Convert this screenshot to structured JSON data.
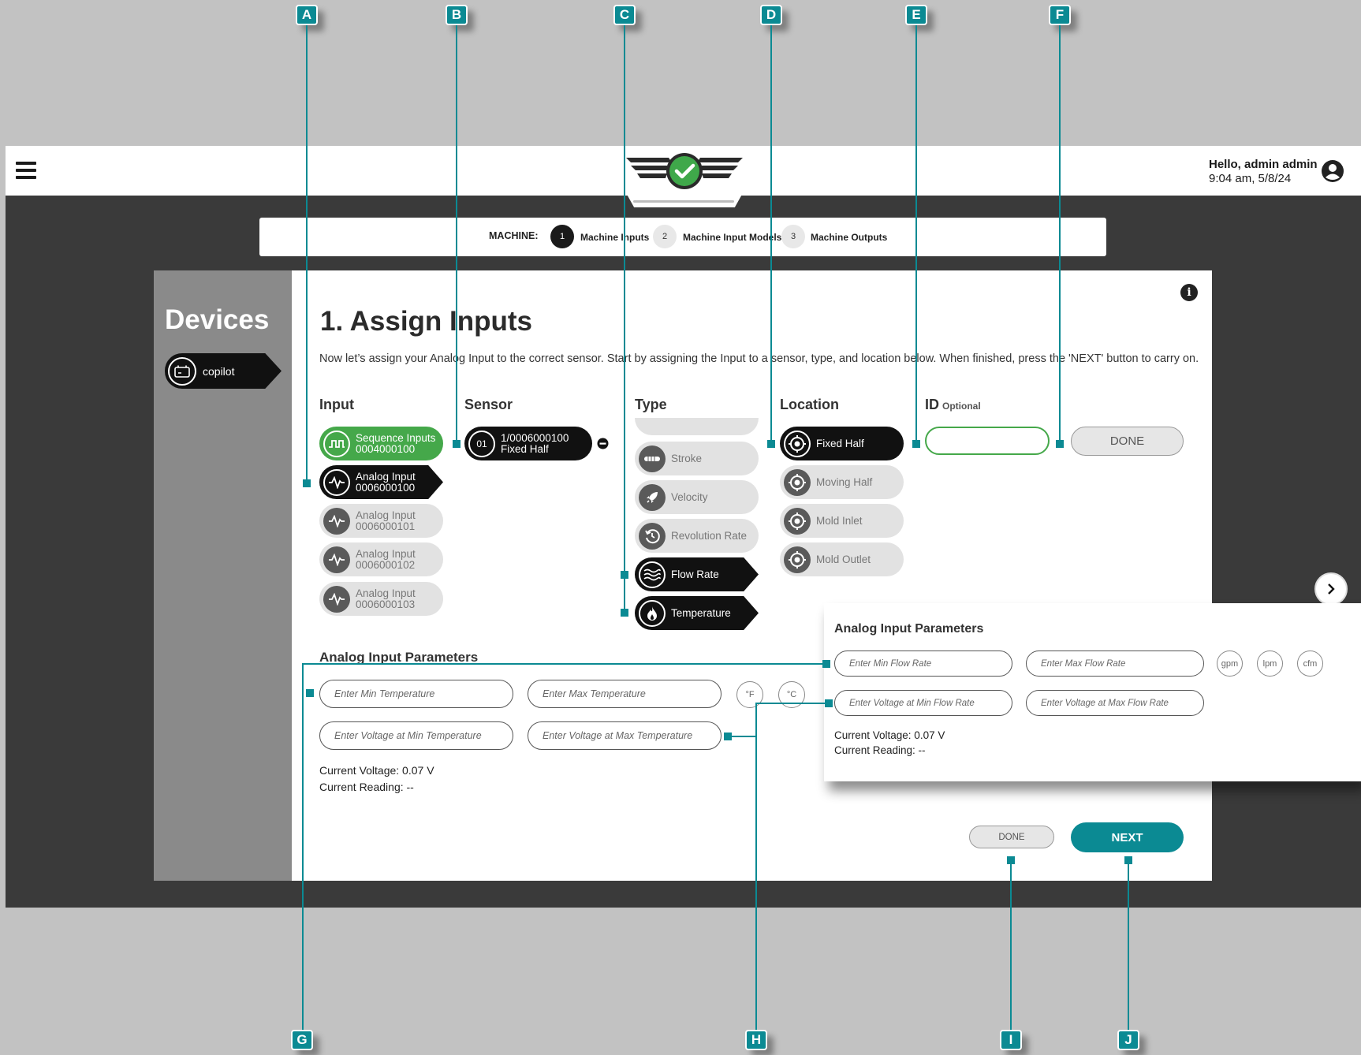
{
  "header": {
    "greeting": "Hello, admin admin",
    "datetime": "9:04 am, 5/8/24"
  },
  "stepper": {
    "label": "MACHINE:",
    "steps": [
      {
        "num": "1",
        "label": "Machine Inputs",
        "active": true
      },
      {
        "num": "2",
        "label": "Machine Input Models",
        "active": false
      },
      {
        "num": "3",
        "label": "Machine Outputs",
        "active": false
      }
    ]
  },
  "sidebar": {
    "title": "Devices",
    "device": "copilot"
  },
  "main": {
    "title": "1. Assign Inputs",
    "instructions": "Now let’s assign your Analog Input to the correct sensor. Start by assigning the Input to a sensor, type, and location below. When finished, press the 'NEXT' button to carry on.",
    "columns": {
      "input": "Input",
      "sensor": "Sensor",
      "type": "Type",
      "location": "Location",
      "id": "ID",
      "id_optional": "Optional"
    },
    "inputs": [
      {
        "name": "Sequence Inputs",
        "code": "0004000100",
        "state": "green",
        "icon": "sequence-pulse-icon"
      },
      {
        "name": "Analog Input",
        "code": "0006000100",
        "state": "selected",
        "icon": "analog-wave-icon"
      },
      {
        "name": "Analog Input",
        "code": "0006000101",
        "state": "idle",
        "icon": "analog-wave-icon"
      },
      {
        "name": "Analog Input",
        "code": "0006000102",
        "state": "idle",
        "icon": "analog-wave-icon"
      },
      {
        "name": "Analog Input",
        "code": "0006000103",
        "state": "idle",
        "icon": "analog-wave-icon"
      }
    ],
    "sensor": {
      "badge": "01",
      "line1": "1/0006000100",
      "line2": "Fixed Half"
    },
    "types": [
      {
        "label": "Stroke",
        "state": "idle",
        "icon": "stroke-icon"
      },
      {
        "label": "Velocity",
        "state": "idle",
        "icon": "rocket-icon"
      },
      {
        "label": "Revolution Rate",
        "state": "idle",
        "icon": "revolution-icon"
      },
      {
        "label": "Flow Rate",
        "state": "selected",
        "icon": "waves-icon"
      },
      {
        "label": "Temperature",
        "state": "selected",
        "icon": "flame-icon"
      }
    ],
    "locations": [
      {
        "label": "Fixed Half",
        "state": "selected"
      },
      {
        "label": "Moving Half",
        "state": "idle"
      },
      {
        "label": "Mold Inlet",
        "state": "idle"
      },
      {
        "label": "Mold Outlet",
        "state": "idle"
      }
    ],
    "id_value": "",
    "done_label": "DONE"
  },
  "parameters": {
    "title": "Analog Input Parameters",
    "min_placeholder": "Enter Min Temperature",
    "max_placeholder": "Enter Max Temperature",
    "vmin_placeholder": "Enter Voltage at Min Temperature",
    "vmax_placeholder": "Enter Voltage at Max Temperature",
    "units": [
      "°F",
      "°C"
    ],
    "voltage": "Current Voltage: 0.07 V",
    "reading": "Current Reading: --"
  },
  "overlay": {
    "title": "Analog Input Parameters",
    "min_placeholder": "Enter Min Flow Rate",
    "max_placeholder": "Enter Max Flow Rate",
    "vmin_placeholder": "Enter Voltage at Min Flow Rate",
    "vmax_placeholder": "Enter Voltage at Max Flow Rate",
    "units": [
      "gpm",
      "lpm",
      "cfm"
    ],
    "voltage": "Current Voltage: 0.07 V",
    "reading": "Current Reading: --"
  },
  "footer": {
    "done_label": "DONE",
    "next_label": "NEXT"
  },
  "callouts": [
    "A",
    "B",
    "C",
    "D",
    "E",
    "F",
    "G",
    "H",
    "I",
    "J"
  ],
  "colors": {
    "accent": "#0b8a93",
    "green": "#45a84a",
    "selected": "#111111",
    "idle": "#e2e2e2"
  }
}
